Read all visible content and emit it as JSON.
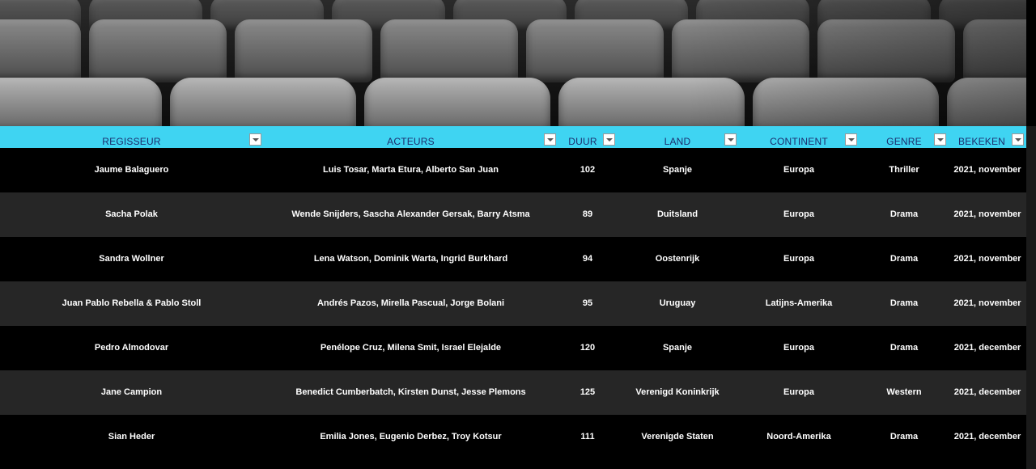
{
  "banner": {
    "image": "cinema-seats"
  },
  "table": {
    "columns": [
      {
        "key": "regisseur",
        "label": "REGISSEUR"
      },
      {
        "key": "acteurs",
        "label": "ACTEURS"
      },
      {
        "key": "duur",
        "label": "DUUR"
      },
      {
        "key": "land",
        "label": "LAND"
      },
      {
        "key": "continent",
        "label": "CONTINENT"
      },
      {
        "key": "genre",
        "label": "GENRE"
      },
      {
        "key": "bekeken",
        "label": "BEKEKEN"
      }
    ],
    "rows": [
      {
        "regisseur": "Jaume Balaguero",
        "acteurs": "Luis Tosar, Marta Etura, Alberto San Juan",
        "duur": "102",
        "land": "Spanje",
        "continent": "Europa",
        "genre": "Thriller",
        "bekeken": "2021, november"
      },
      {
        "regisseur": "Sacha Polak",
        "acteurs": "Wende Snijders, Sascha Alexander Gersak, Barry Atsma",
        "duur": "89",
        "land": "Duitsland",
        "continent": "Europa",
        "genre": "Drama",
        "bekeken": "2021, november"
      },
      {
        "regisseur": "Sandra Wollner",
        "acteurs": "Lena Watson, Dominik Warta, Ingrid Burkhard",
        "duur": "94",
        "land": "Oostenrijk",
        "continent": "Europa",
        "genre": "Drama",
        "bekeken": "2021, november"
      },
      {
        "regisseur": "Juan Pablo Rebella & Pablo Stoll",
        "acteurs": "Andrés Pazos, Mirella Pascual, Jorge Bolani",
        "duur": "95",
        "land": "Uruguay",
        "continent": "Latijns-Amerika",
        "genre": "Drama",
        "bekeken": "2021, november"
      },
      {
        "regisseur": "Pedro Almodovar",
        "acteurs": "Penélope Cruz, Milena Smit, Israel Elejalde",
        "duur": "120",
        "land": "Spanje",
        "continent": "Europa",
        "genre": "Drama",
        "bekeken": "2021, december"
      },
      {
        "regisseur": "Jane Campion",
        "acteurs": "Benedict Cumberbatch, Kirsten Dunst, Jesse Plemons",
        "duur": "125",
        "land": "Verenigd Koninkrijk",
        "continent": "Europa",
        "genre": "Western",
        "bekeken": "2021, december"
      },
      {
        "regisseur": "Sian Heder",
        "acteurs": "Emilia Jones, Eugenio Derbez, Troy Kotsur",
        "duur": "111",
        "land": "Verenigde Staten",
        "continent": "Noord-Amerika",
        "genre": "Drama",
        "bekeken": "2021, december"
      }
    ]
  },
  "colors": {
    "header_bg": "#3fd4f2",
    "header_text": "#1c2e6e",
    "row_dark": "#000000",
    "row_light": "#262626",
    "cell_text": "#ffffff"
  },
  "icons": {
    "filter": "filter-dropdown-icon"
  }
}
